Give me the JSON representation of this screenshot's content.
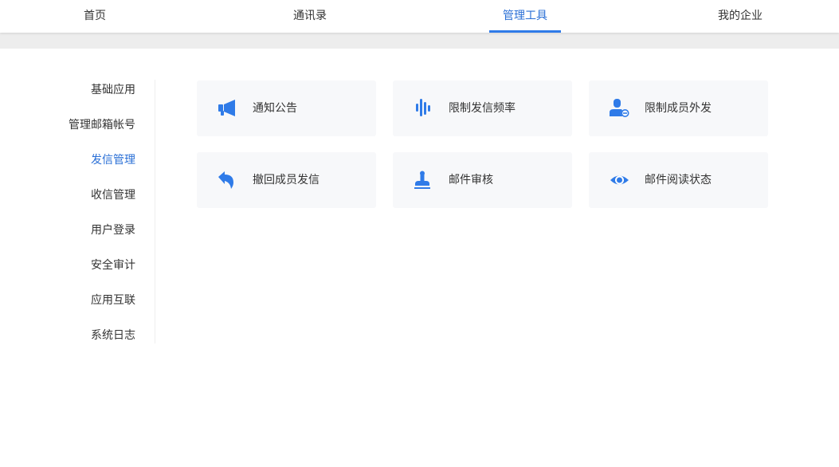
{
  "topnav": {
    "tabs": [
      {
        "label": "首页"
      },
      {
        "label": "通讯录"
      },
      {
        "label": "管理工具"
      },
      {
        "label": "我的企业"
      }
    ],
    "active_index": 2
  },
  "sidebar": {
    "items": [
      {
        "label": "基础应用"
      },
      {
        "label": "管理邮箱帐号"
      },
      {
        "label": "发信管理"
      },
      {
        "label": "收信管理"
      },
      {
        "label": "用户登录"
      },
      {
        "label": "安全审计"
      },
      {
        "label": "应用互联"
      },
      {
        "label": "系统日志"
      }
    ],
    "active_index": 2
  },
  "tools": {
    "cards": [
      {
        "label": "通知公告",
        "icon": "megaphone-icon"
      },
      {
        "label": "限制发信频率",
        "icon": "frequency-bars-icon"
      },
      {
        "label": "限制成员外发",
        "icon": "user-restrict-icon"
      },
      {
        "label": "撤回成员发信",
        "icon": "undo-arrow-icon"
      },
      {
        "label": "邮件审核",
        "icon": "stamp-icon"
      },
      {
        "label": "邮件阅读状态",
        "icon": "eye-icon"
      }
    ]
  },
  "colors": {
    "accent": "#2f7be8",
    "active_text": "#2a6fd6",
    "card_bg": "#f7f8fa",
    "band": "#ededed"
  }
}
